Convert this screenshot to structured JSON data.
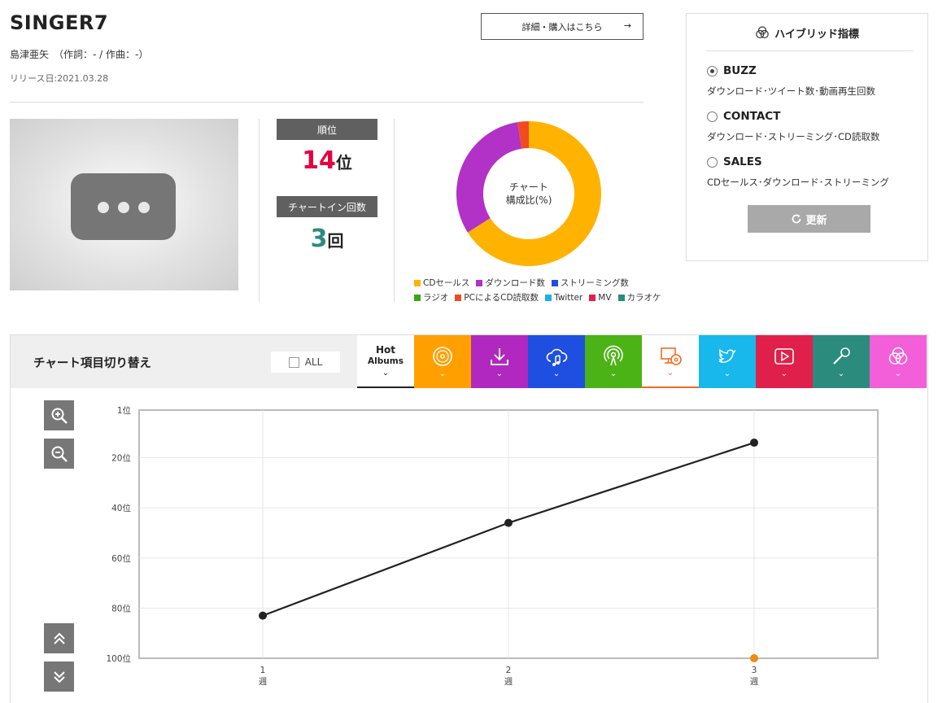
{
  "song": {
    "title": "SINGER7",
    "credit": "島津亜矢　（作詞：- / 作曲：-）",
    "release": "リリース日:2021.03.28",
    "detail_button": "詳細・購入はこちら",
    "detail_arrow": "→"
  },
  "rank": {
    "label": "順位",
    "value": "14",
    "unit": "位"
  },
  "chart_in": {
    "label": "チャートイン回数",
    "value": "3",
    "unit": "回"
  },
  "donut": {
    "center_line1": "チャート",
    "center_line2": "構成比(%)",
    "legend": [
      {
        "name": "CDセールス",
        "color": "#ffb300"
      },
      {
        "name": "ダウンロード数",
        "color": "#b231c7"
      },
      {
        "name": "ストリーミング数",
        "color": "#1f4fe0"
      },
      {
        "name": "ラジオ",
        "color": "#3aa812"
      },
      {
        "name": "PCによるCD読取数",
        "color": "#f24b22"
      },
      {
        "name": "Twitter",
        "color": "#19b0e8"
      },
      {
        "name": "MV",
        "color": "#e0204a"
      },
      {
        "name": "カラオケ",
        "color": "#2b8c7d"
      }
    ],
    "slices": [
      {
        "name": "CDセールス",
        "value": 66,
        "color": "#ffb300"
      },
      {
        "name": "ダウンロード数",
        "value": 31.5,
        "color": "#b231c7"
      },
      {
        "name": "PCによるCD読取数",
        "value": 2.5,
        "color": "#f24b22"
      }
    ]
  },
  "hybrid": {
    "title": "ハイブリッド指標",
    "options": [
      {
        "label": "BUZZ",
        "desc": "ダウンロード･ツイート数･動画再生回数",
        "selected": true
      },
      {
        "label": "CONTACT",
        "desc": "ダウンロード･ストリーミング･CD読取数",
        "selected": false
      },
      {
        "label": "SALES",
        "desc": "CDセールス･ダウンロード･ストリーミング",
        "selected": false
      }
    ],
    "update_label": "更新"
  },
  "switcher": {
    "title": "チャート項目切り替え",
    "all_label": "ALL",
    "hot_tab": {
      "line1": "Hot",
      "line2": "Albums"
    },
    "tabs": [
      {
        "name": "cd-sales",
        "icon": "cd-icon",
        "color": "#ffa000"
      },
      {
        "name": "download",
        "icon": "download-icon",
        "color": "#b028c0"
      },
      {
        "name": "streaming",
        "icon": "cloud-music-icon",
        "color": "#1f4fe0"
      },
      {
        "name": "radio",
        "icon": "radio-icon",
        "color": "#4cb317"
      },
      {
        "name": "pc-cd-read",
        "icon": "pc-cd-icon",
        "color": "#ffffff"
      },
      {
        "name": "twitter",
        "icon": "twitter-icon",
        "color": "#19b8ec"
      },
      {
        "name": "mv",
        "icon": "play-icon",
        "color": "#e0204a"
      },
      {
        "name": "karaoke",
        "icon": "microphone-icon",
        "color": "#2b8c7d"
      },
      {
        "name": "hybrid",
        "icon": "hybrid-icon",
        "color": "#f25fd8"
      }
    ],
    "chevron": "⌄"
  },
  "chart_data": {
    "type": "line",
    "x": [
      1,
      2,
      3
    ],
    "xlabels": [
      "1",
      "2",
      "3"
    ],
    "xunit": "週",
    "ylim": [
      1,
      100
    ],
    "yinverted": true,
    "yticks": [
      1,
      20,
      40,
      60,
      80,
      100
    ],
    "ytick_labels": [
      "1位",
      "20位",
      "40位",
      "60位",
      "80位",
      "100位"
    ],
    "grid": true,
    "series": [
      {
        "values": [
          83,
          46,
          14
        ],
        "color": "#222222"
      },
      {
        "values": [
          null,
          null,
          100
        ],
        "color": "#f08a10"
      }
    ]
  }
}
